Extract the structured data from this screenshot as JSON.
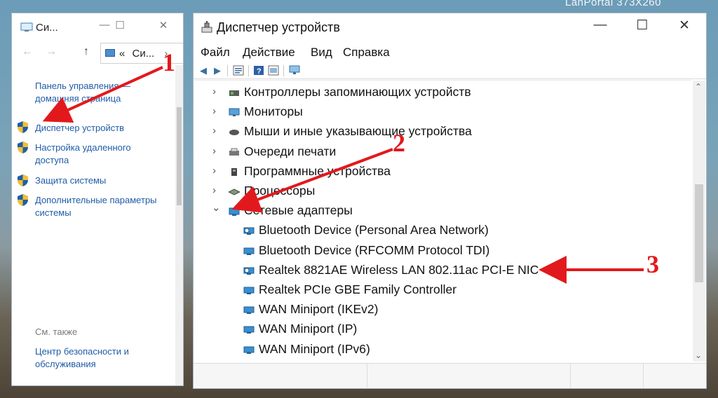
{
  "desktop": {
    "label": "LanPortal   373X260"
  },
  "system_window": {
    "title": "Си...",
    "controls": [
      "—",
      "☐",
      "✕"
    ],
    "nav": {
      "back": "←",
      "forward": "→",
      "up": "↑",
      "address_prefix": "«",
      "address": "Си...",
      "address_sep": "›"
    },
    "links": {
      "control_panel_line1": "Панель управления —",
      "control_panel_line2": "домашняя страница",
      "device_manager": "Диспетчер устройств",
      "remote_line1": "Настройка удаленного",
      "remote_line2": "доступа",
      "protection": "Защита системы",
      "advanced_line1": "Дополнительные параметры",
      "advanced_line2": "системы",
      "see_also": "См. также",
      "security_line1": "Центр безопасности и",
      "security_line2": "обслуживания"
    }
  },
  "device_manager": {
    "title": "Диспетчер устройств",
    "controls": [
      "—",
      "☐",
      "✕"
    ],
    "menu": [
      "Файл",
      "Действие",
      "Вид",
      "Справка"
    ],
    "categories": [
      {
        "label": "Контроллеры запоминающих устройств",
        "chevron": "›",
        "icon": "storage-controller-icon"
      },
      {
        "label": "Мониторы",
        "chevron": "›",
        "icon": "monitor-icon"
      },
      {
        "label": "Мыши и иные указывающие устройства",
        "chevron": "›",
        "icon": "mouse-icon"
      },
      {
        "label": "Очереди печати",
        "chevron": "›",
        "icon": "printer-icon"
      },
      {
        "label": "Программные устройства",
        "chevron": "›",
        "icon": "software-device-icon"
      },
      {
        "label": "Процессоры",
        "chevron": "›",
        "icon": "processor-icon"
      },
      {
        "label": "Сетевые адаптеры",
        "chevron": "⌄",
        "icon": "network-adapter-icon"
      }
    ],
    "adapters": [
      {
        "label": "Bluetooth Device (Personal Area Network)",
        "icon": "bluetooth-adapter-icon"
      },
      {
        "label": "Bluetooth Device (RFCOMM Protocol TDI)",
        "icon": "network-adapter-icon"
      },
      {
        "label": "Realtek 8821AE Wireless LAN 802.11ac PCI-E NIC",
        "icon": "wireless-adapter-icon"
      },
      {
        "label": "Realtek PCIe GBE Family Controller",
        "icon": "network-adapter-icon"
      },
      {
        "label": "WAN Miniport (IKEv2)",
        "icon": "network-adapter-icon"
      },
      {
        "label": "WAN Miniport (IP)",
        "icon": "network-adapter-icon"
      },
      {
        "label": "WAN Miniport (IPv6)",
        "icon": "network-adapter-icon"
      }
    ]
  },
  "annotations": [
    "1",
    "2",
    "3"
  ],
  "colors": {
    "link": "#1f5ca8",
    "annotation": "#e2191c",
    "adapter_icon": "#3a8fd0"
  }
}
